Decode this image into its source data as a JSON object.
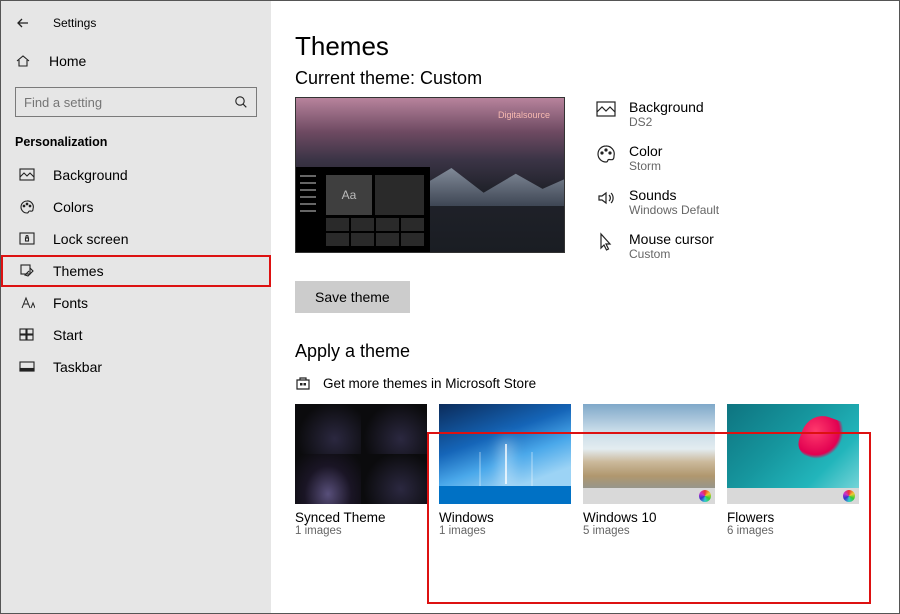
{
  "app_title": "Settings",
  "home_label": "Home",
  "search": {
    "placeholder": "Find a setting"
  },
  "category_title": "Personalization",
  "nav": [
    {
      "label": "Background"
    },
    {
      "label": "Colors"
    },
    {
      "label": "Lock screen"
    },
    {
      "label": "Themes"
    },
    {
      "label": "Fonts"
    },
    {
      "label": "Start"
    },
    {
      "label": "Taskbar"
    }
  ],
  "page": {
    "title": "Themes",
    "current_theme_label": "Current theme: Custom",
    "preview_watermark": "Digitalsource",
    "preview_aa": "Aa",
    "props": {
      "background": {
        "name": "Background",
        "value": "DS2"
      },
      "color": {
        "name": "Color",
        "value": "Storm"
      },
      "sounds": {
        "name": "Sounds",
        "value": "Windows Default"
      },
      "cursor": {
        "name": "Mouse cursor",
        "value": "Custom"
      }
    },
    "save_button": "Save theme",
    "apply_heading": "Apply a theme",
    "store_link": "Get more themes in Microsoft Store",
    "themes": [
      {
        "name": "Synced Theme",
        "count": "1 images"
      },
      {
        "name": "Windows",
        "count": "1 images"
      },
      {
        "name": "Windows 10",
        "count": "5 images"
      },
      {
        "name": "Flowers",
        "count": "6 images"
      }
    ]
  }
}
